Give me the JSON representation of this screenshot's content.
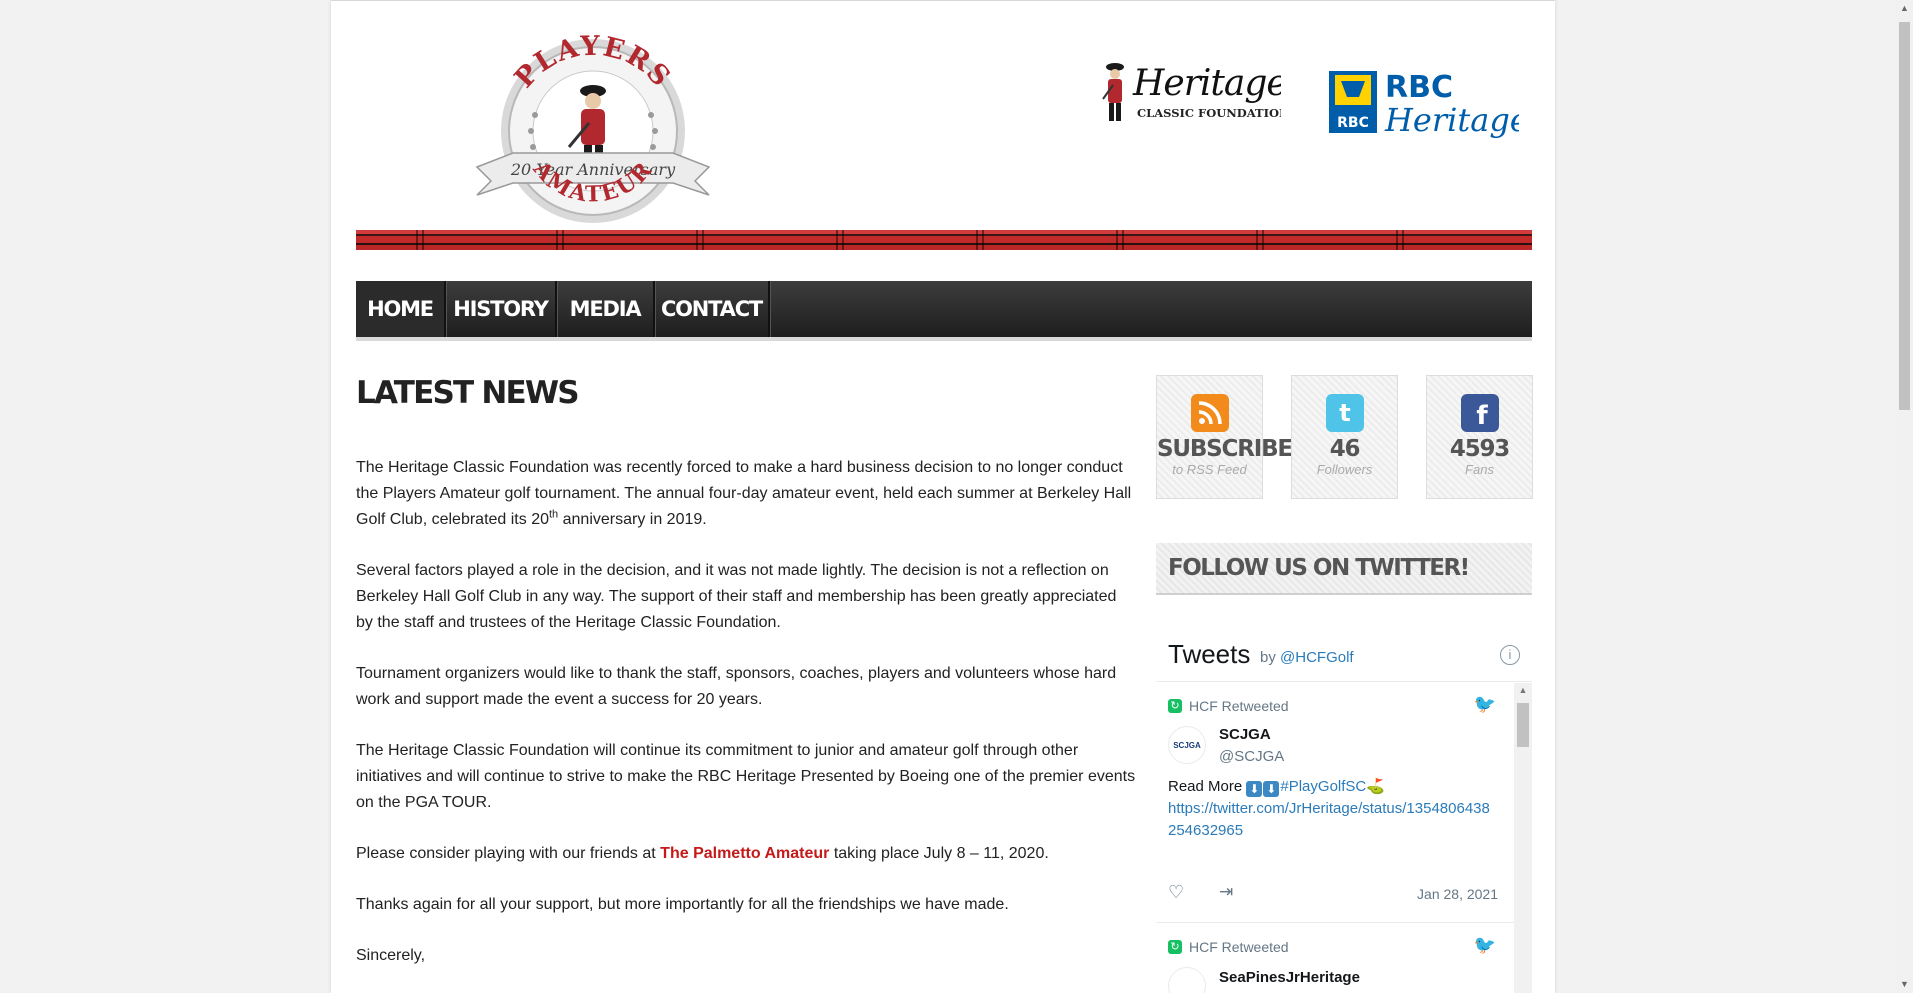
{
  "header": {
    "players_logo": {
      "top_text": "PLAYERS",
      "banner_text": "20 Year Anniversary",
      "bottom_text": "AMATEUR"
    },
    "heritage_logo": {
      "title": "Heritage",
      "subtitle": "CLASSIC FOUNDATION"
    },
    "rbc_logo": {
      "badge": "RBC",
      "line1": "RBC",
      "line2": "Heritage"
    }
  },
  "nav": {
    "items": [
      {
        "label": "HOME"
      },
      {
        "label": "HISTORY"
      },
      {
        "label": "MEDIA"
      },
      {
        "label": "CONTACT"
      }
    ]
  },
  "main": {
    "title": "LATEST NEWS",
    "p1_a": "The Heritage Classic Foundation was recently forced to make a hard business decision to no longer conduct the Players Amateur golf tournament. The annual four-day amateur event, held each summer at Berkeley Hall Golf Club, celebrated its 20",
    "p1_sup": "th",
    "p1_b": " anniversary in 2019.",
    "p2": "Several factors played a role in the decision, and it was not made lightly. The decision is not a reflection on Berkeley Hall Golf Club in any way. The support of their staff and membership has been greatly appreciated by the staff and trustees of the Heritage Classic Foundation.",
    "p3": "Tournament organizers would like to thank the staff, sponsors, coaches, players and volunteers whose hard work and support made the event a success for 20 years.",
    "p4": "The Heritage Classic Foundation will continue its commitment to junior and amateur golf through other initiatives and will continue to strive to make the RBC Heritage Presented by Boeing one of the premier events on the PGA TOUR.",
    "p5_a": "Please consider playing with our friends at ",
    "p5_link": "The Palmetto Amateur",
    "p5_b": " taking place July 8 – 11, 2020.",
    "p6": "Thanks again for all your support, but more importantly for all the friendships we have made.",
    "p7": "Sincerely,"
  },
  "sidebar": {
    "rss": {
      "big": "SUBSCRIBE",
      "small": "to RSS Feed",
      "icon": "rss-icon",
      "color": "#f28a1c"
    },
    "twitter": {
      "big": "46",
      "small": "Followers",
      "icon": "twitter-icon",
      "color": "#4fc3e8"
    },
    "facebook": {
      "big": "4593",
      "small": "Fans",
      "icon": "facebook-icon",
      "color": "#3b5998"
    },
    "follow_title": "FOLLOW US ON TWITTER!"
  },
  "tweets": {
    "title": "Tweets",
    "by": "by",
    "handle": "@HCFGolf",
    "items": [
      {
        "retweeted": "HCF Retweeted",
        "name": "SCJGA",
        "handle": "@SCJGA",
        "avatar": "SCJGA",
        "text_a": "Read More ",
        "hashtag": "#PlayGolfSC",
        "link": "https://twitter.com/JrHeritage/status/1354806438254632965",
        "date": "Jan 28, 2021"
      },
      {
        "retweeted": "HCF Retweeted",
        "name": "SeaPinesJrHeritage"
      }
    ]
  }
}
